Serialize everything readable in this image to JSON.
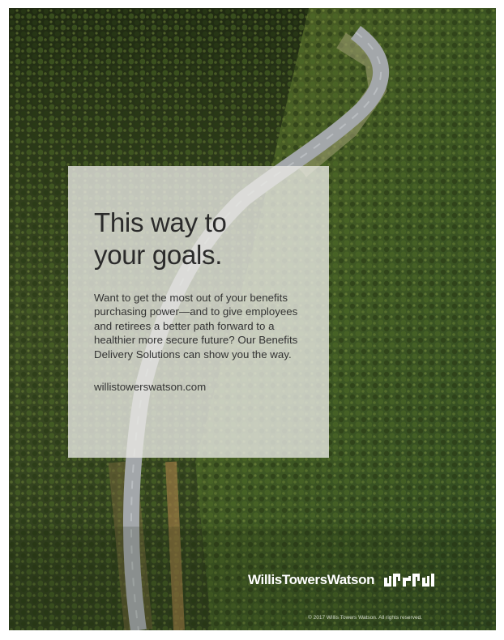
{
  "ad": {
    "headline_line1": "This way to",
    "headline_line2": "your goals.",
    "body": "Want to get the most out of your benefits purchasing power—and to give employees and retirees a better path forward to a healthier more secure future? Our Benefits Delivery Solutions can show you the way.",
    "url": "willistowerswatson.com",
    "brand": "WillisTowersWatson",
    "copyright": "© 2017 Willis Towers Watson. All rights reserved."
  },
  "colors": {
    "panel": "#e8e8e4",
    "forest_dark": "#2c3a1c",
    "road": "#9aa0a6",
    "brand_text": "#ffffff"
  }
}
